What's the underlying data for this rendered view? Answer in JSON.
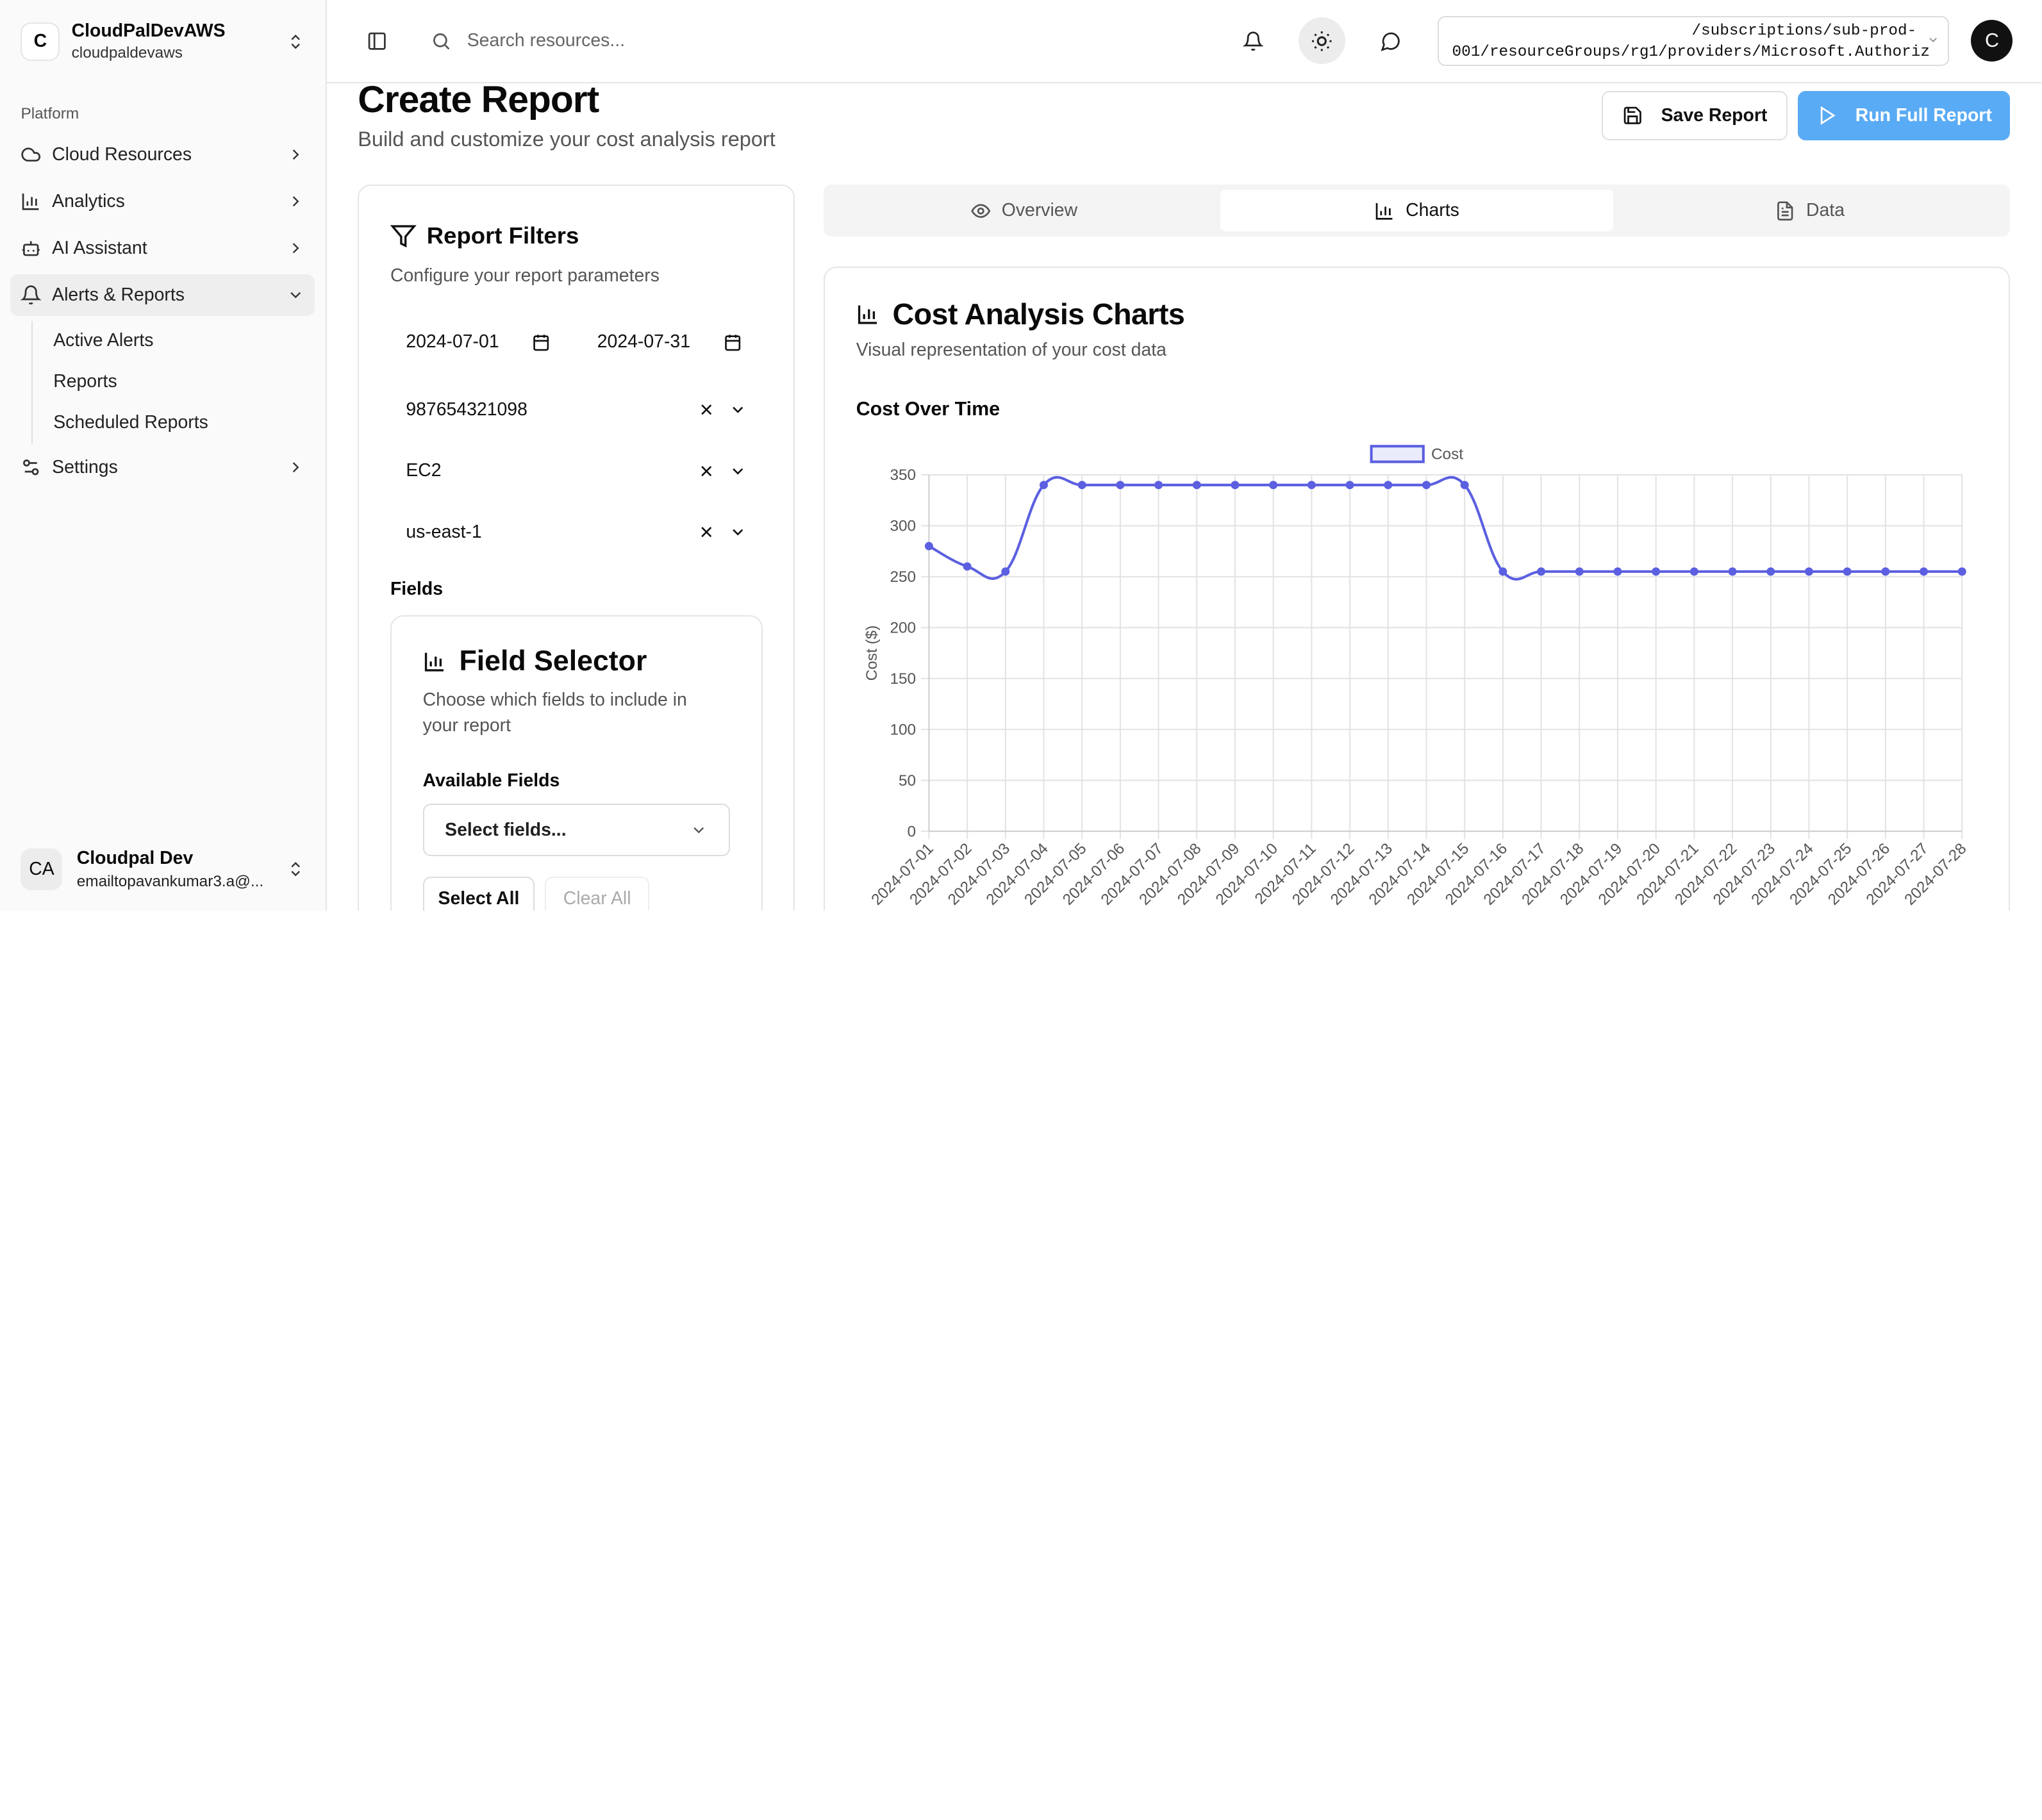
{
  "sidebar": {
    "org": {
      "initial": "C",
      "name": "CloudPalDevAWS",
      "sub": "cloudpaldevaws"
    },
    "section": "Platform",
    "items": [
      {
        "label": "Cloud Resources",
        "icon": "cloud-icon"
      },
      {
        "label": "Analytics",
        "icon": "bar-chart-icon"
      },
      {
        "label": "AI Assistant",
        "icon": "bot-icon"
      },
      {
        "label": "Alerts & Reports",
        "icon": "bell-icon"
      },
      {
        "label": "Settings",
        "icon": "sliders-icon"
      }
    ],
    "subitems": [
      "Active Alerts",
      "Reports",
      "Scheduled Reports"
    ],
    "user": {
      "initials": "CA",
      "name": "Cloudpal Dev",
      "email": "emailtopavankumar3.a@..."
    }
  },
  "topbar": {
    "search_placeholder": "Search resources...",
    "path_line1": "/subscriptions/sub-prod-",
    "path_line2": "001/resourceGroups/rg1/providers/Microsoft.Authoriz",
    "avatar": "C"
  },
  "page": {
    "title": "Create Report",
    "subtitle": "Build and customize your cost analysis report",
    "save_label": "Save Report",
    "run_label": "Run Full Report"
  },
  "filters": {
    "title": "Report Filters",
    "subtitle": "Configure your report parameters",
    "start_date": "2024-07-01",
    "end_date": "2024-07-31",
    "account": "987654321098",
    "service": "EC2",
    "region": "us-east-1",
    "fields_label": "Fields",
    "field_selector": {
      "title": "Field Selector",
      "subtitle": "Choose which fields to include in your report",
      "available_label": "Available Fields",
      "placeholder": "Select fields...",
      "select_all": "Select All",
      "clear_all": "Clear All"
    }
  },
  "tabs": [
    {
      "label": "Overview",
      "icon": "eye-icon"
    },
    {
      "label": "Charts",
      "icon": "bar-chart-icon"
    },
    {
      "label": "Data",
      "icon": "file-text-icon"
    }
  ],
  "chart_card": {
    "title": "Cost Analysis Charts",
    "subtitle": "Visual representation of your cost data",
    "chart_title": "Cost Over Time"
  },
  "colors": {
    "accent": "#5aabf5",
    "series": "#5b5fe0"
  },
  "chart_data": {
    "type": "line",
    "title": "Cost Over Time",
    "xlabel": "",
    "ylabel": "Cost ($)",
    "ylim": [
      0,
      350
    ],
    "yticks": [
      0,
      50,
      100,
      150,
      200,
      250,
      300,
      350
    ],
    "legend": "top-center",
    "grid": true,
    "categories": [
      "2024-07-01",
      "2024-07-02",
      "2024-07-03",
      "2024-07-04",
      "2024-07-05",
      "2024-07-06",
      "2024-07-07",
      "2024-07-08",
      "2024-07-09",
      "2024-07-10",
      "2024-07-11",
      "2024-07-12",
      "2024-07-13",
      "2024-07-14",
      "2024-07-15",
      "2024-07-16",
      "2024-07-17",
      "2024-07-18",
      "2024-07-19",
      "2024-07-20",
      "2024-07-21",
      "2024-07-22",
      "2024-07-23",
      "2024-07-24",
      "2024-07-25",
      "2024-07-26",
      "2024-07-27",
      "2024-07-28"
    ],
    "series": [
      {
        "name": "Cost",
        "values": [
          280,
          260,
          255,
          340,
          340,
          340,
          340,
          340,
          340,
          340,
          340,
          340,
          340,
          340,
          340,
          255,
          255,
          255,
          255,
          255,
          255,
          255,
          255,
          255,
          255,
          255,
          255,
          255
        ]
      }
    ]
  }
}
